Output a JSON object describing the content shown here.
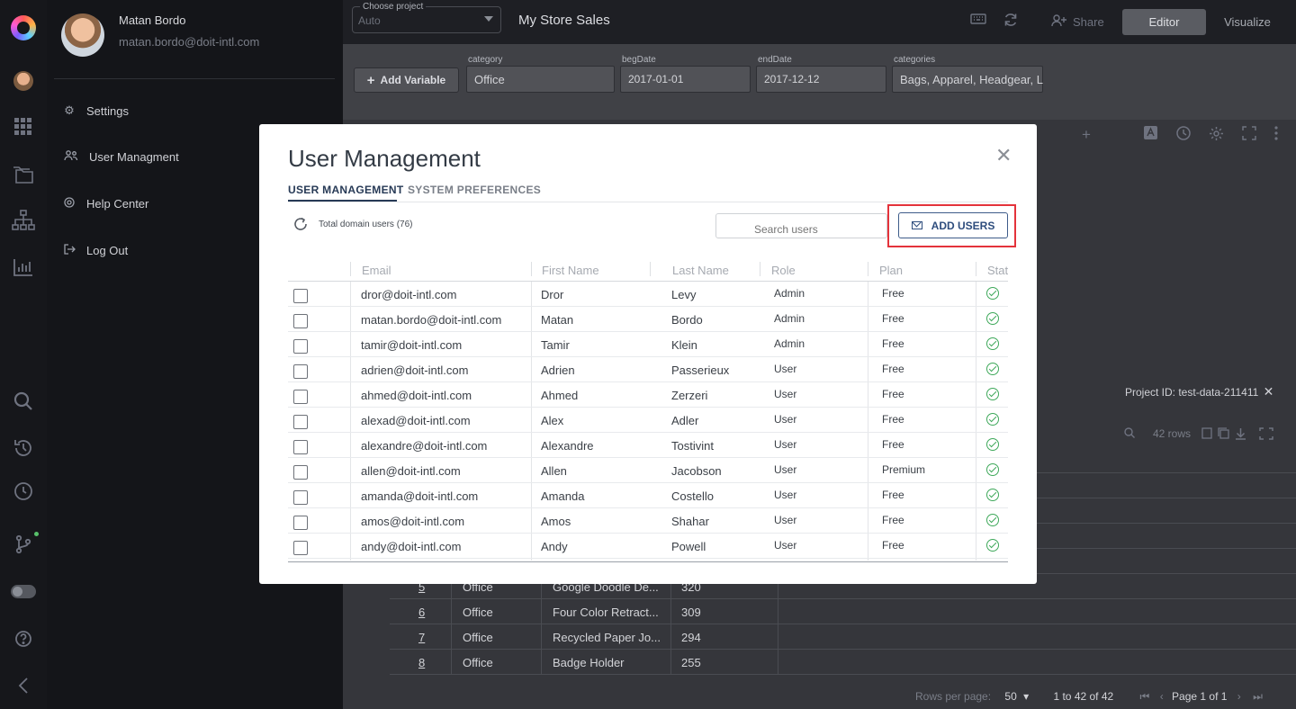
{
  "user": {
    "name": "Matan Bordo",
    "email": "matan.bordo@doit-intl.com"
  },
  "user_menu": [
    {
      "label": "Settings",
      "icon": "gear-icon"
    },
    {
      "label": "User Managment",
      "icon": "users-icon"
    },
    {
      "label": "Help Center",
      "icon": "lifebuoy-icon"
    },
    {
      "label": "Log Out",
      "icon": "logout-icon"
    }
  ],
  "topbar": {
    "project_label": "Choose project",
    "project_value": "Auto",
    "title": "My Store Sales",
    "share": "Share",
    "editor": "Editor",
    "visualize": "Visualize"
  },
  "variables": {
    "add_label": "Add Variable",
    "items": [
      {
        "label": "category",
        "value": "Office"
      },
      {
        "label": "begDate",
        "value": "2017-01-01"
      },
      {
        "label": "endDate",
        "value": "2017-12-12"
      },
      {
        "label": "categories",
        "value": "Bags, Apparel, Headgear, L"
      }
    ]
  },
  "project_id": "Project ID: test-data-211411",
  "rows_count": "42 rows",
  "background_rows": [
    {
      "n": "5",
      "category": "Office",
      "product": "Google Doodle De...",
      "qty": "320"
    },
    {
      "n": "6",
      "category": "Office",
      "product": "Four Color Retract...",
      "qty": "309"
    },
    {
      "n": "7",
      "category": "Office",
      "product": "Recycled Paper Jo...",
      "qty": "294"
    },
    {
      "n": "8",
      "category": "Office",
      "product": "Badge Holder",
      "qty": "255"
    }
  ],
  "pager": {
    "rows_per_page_label": "Rows per page:",
    "rows_per_page": "50",
    "range": "1 to 42 of 42",
    "page": "Page 1 of 1"
  },
  "modal": {
    "title": "User Management",
    "tabs": [
      "USER MANAGEMENT",
      "SYSTEM PREFERENCES"
    ],
    "total_users": "Total domain users (76)",
    "search_placeholder": "Search users",
    "add_users": "ADD USERS",
    "columns": [
      "Email",
      "First Name",
      "Last Name",
      "Role",
      "Plan",
      "Stat"
    ],
    "rows": [
      {
        "email": "dror@doit-intl.com",
        "first": "Dror",
        "last": "Levy",
        "role": "Admin",
        "plan": "Free"
      },
      {
        "email": "matan.bordo@doit-intl.com",
        "first": "Matan",
        "last": "Bordo",
        "role": "Admin",
        "plan": "Free"
      },
      {
        "email": "tamir@doit-intl.com",
        "first": "Tamir",
        "last": "Klein",
        "role": "Admin",
        "plan": "Free"
      },
      {
        "email": "adrien@doit-intl.com",
        "first": "Adrien",
        "last": "Passerieux",
        "role": "User",
        "plan": "Free"
      },
      {
        "email": "ahmed@doit-intl.com",
        "first": "Ahmed",
        "last": "Zerzeri",
        "role": "User",
        "plan": "Free"
      },
      {
        "email": "alexad@doit-intl.com",
        "first": "Alex",
        "last": "Adler",
        "role": "User",
        "plan": "Free"
      },
      {
        "email": "alexandre@doit-intl.com",
        "first": "Alexandre",
        "last": "Tostivint",
        "role": "User",
        "plan": "Free"
      },
      {
        "email": "allen@doit-intl.com",
        "first": "Allen",
        "last": "Jacobson",
        "role": "User",
        "plan": "Premium"
      },
      {
        "email": "amanda@doit-intl.com",
        "first": "Amanda",
        "last": "Costello",
        "role": "User",
        "plan": "Free"
      },
      {
        "email": "amos@doit-intl.com",
        "first": "Amos",
        "last": "Shahar",
        "role": "User",
        "plan": "Free"
      },
      {
        "email": "andy@doit-intl.com",
        "first": "Andy",
        "last": "Powell",
        "role": "User",
        "plan": "Free"
      }
    ]
  }
}
